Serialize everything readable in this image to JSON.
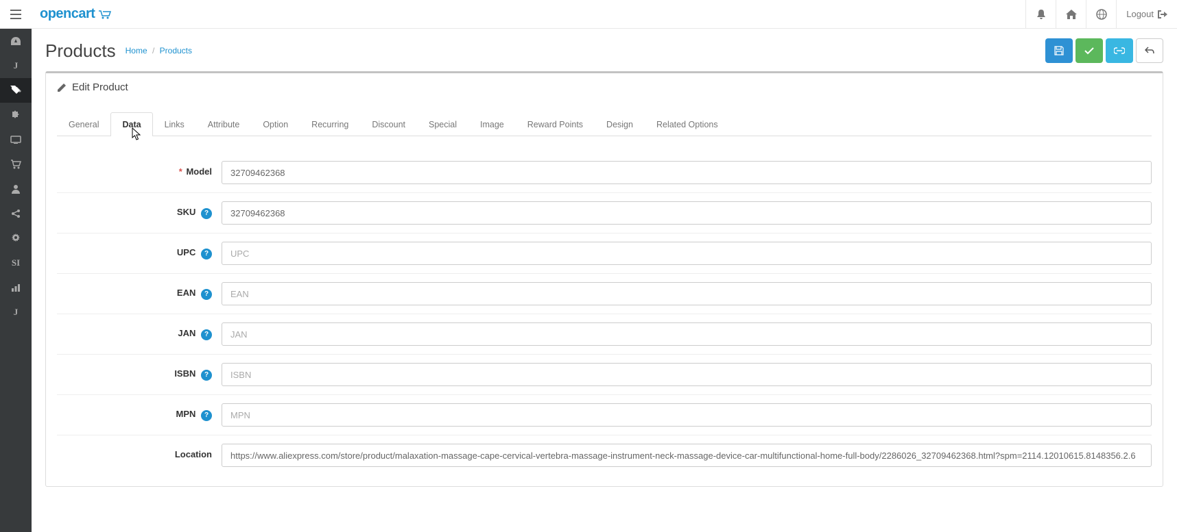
{
  "brand": "opencart",
  "header": {
    "logout": "Logout"
  },
  "page": {
    "title": "Products",
    "breadcrumb_home": "Home",
    "breadcrumb_current": "Products"
  },
  "panel": {
    "heading": "Edit Product"
  },
  "tabs": [
    {
      "label": "General",
      "active": false
    },
    {
      "label": "Data",
      "active": true
    },
    {
      "label": "Links",
      "active": false
    },
    {
      "label": "Attribute",
      "active": false
    },
    {
      "label": "Option",
      "active": false
    },
    {
      "label": "Recurring",
      "active": false
    },
    {
      "label": "Discount",
      "active": false
    },
    {
      "label": "Special",
      "active": false
    },
    {
      "label": "Image",
      "active": false
    },
    {
      "label": "Reward Points",
      "active": false
    },
    {
      "label": "Design",
      "active": false
    },
    {
      "label": "Related Options",
      "active": false
    }
  ],
  "form": {
    "model": {
      "label": "Model",
      "value": "32709462368",
      "required": true,
      "help": false
    },
    "sku": {
      "label": "SKU",
      "value": "32709462368",
      "required": false,
      "help": true
    },
    "upc": {
      "label": "UPC",
      "value": "",
      "placeholder": "UPC",
      "required": false,
      "help": true
    },
    "ean": {
      "label": "EAN",
      "value": "",
      "placeholder": "EAN",
      "required": false,
      "help": true
    },
    "jan": {
      "label": "JAN",
      "value": "",
      "placeholder": "JAN",
      "required": false,
      "help": true
    },
    "isbn": {
      "label": "ISBN",
      "value": "",
      "placeholder": "ISBN",
      "required": false,
      "help": true
    },
    "mpn": {
      "label": "MPN",
      "value": "",
      "placeholder": "MPN",
      "required": false,
      "help": true
    },
    "location": {
      "label": "Location",
      "value": "https://www.aliexpress.com/store/product/malaxation-massage-cape-cervical-vertebra-massage-instrument-neck-massage-device-car-multifunctional-home-full-body/2286026_32709462368.html?spm=2114.12010615.8148356.2.6",
      "required": false,
      "help": false
    }
  },
  "sidebar_text_items": {
    "j1": "J",
    "si": "SI",
    "j2": "J"
  }
}
